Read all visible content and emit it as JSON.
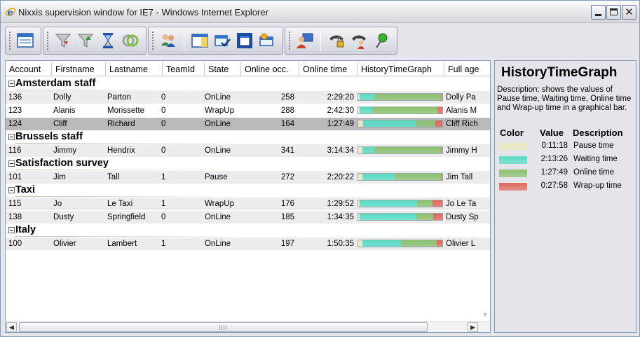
{
  "window": {
    "title": "Nixxis supervision window for IE7 - Windows Internet Explorer",
    "close_glyph": "✕"
  },
  "toolbar": {
    "groups": [
      [
        "window-icon"
      ],
      [
        "filter-down-icon",
        "filter-up-icon",
        "hourglass-icon",
        "rings-icon"
      ],
      [
        "agents-icon",
        "panel-icon",
        "check-window-icon",
        "maximize-window-icon",
        "window-star-icon"
      ],
      [
        "agent-computer-icon",
        "phone-lock-icon",
        "phone-agent-icon",
        "pin-icon"
      ]
    ]
  },
  "grid": {
    "columns": [
      "Account",
      "Firstname",
      "Lastname",
      "TeamId",
      "State",
      "Online occ.",
      "Online time",
      "HistoryTimeGraph",
      "Full age"
    ],
    "groups": [
      {
        "name": "Amsterdam staff",
        "rows": [
          {
            "account": "136",
            "firstname": "Dolly",
            "lastname": "Parton",
            "teamid": "0",
            "state": "OnLine",
            "online_occ": "258",
            "online_time": "2:29:20",
            "full": "Dolly Pa",
            "graph": [
              0.02,
              0.17,
              0.8,
              0.01
            ],
            "style": "alt"
          },
          {
            "account": "123",
            "firstname": "Alanis",
            "lastname": "Morissette",
            "teamid": "0",
            "state": "WrapUp",
            "online_occ": "288",
            "online_time": "2:42:30",
            "full": "Alanis M",
            "graph": [
              0.02,
              0.15,
              0.77,
              0.06
            ],
            "style": ""
          },
          {
            "account": "124",
            "firstname": "Cliff",
            "lastname": "Richard",
            "teamid": "0",
            "state": "OnLine",
            "online_occ": "164",
            "online_time": "1:27:49",
            "full": "Cliff Rich",
            "graph": [
              0.06,
              0.62,
              0.24,
              0.08
            ],
            "style": "sel"
          }
        ]
      },
      {
        "name": "Brussels staff",
        "rows": [
          {
            "account": "116",
            "firstname": "Jimmy",
            "lastname": "Hendrix",
            "teamid": "0",
            "state": "OnLine",
            "online_occ": "341",
            "online_time": "3:14:34",
            "full": "Jimmy H",
            "graph": [
              0.05,
              0.14,
              0.8,
              0.01
            ],
            "style": "alt"
          }
        ]
      },
      {
        "name": "Satisfaction survey",
        "rows": [
          {
            "account": "101",
            "firstname": "Jim",
            "lastname": "Tall",
            "teamid": "1",
            "state": "Pause",
            "online_occ": "272",
            "online_time": "2:20:22",
            "full": "Jim Tall",
            "graph": [
              0.05,
              0.38,
              0.56,
              0.01
            ],
            "style": "alt"
          }
        ]
      },
      {
        "name": "Taxi",
        "rows": [
          {
            "account": "115",
            "firstname": "Jo",
            "lastname": "Le Taxi",
            "teamid": "1",
            "state": "WrapUp",
            "online_occ": "176",
            "online_time": "1:29:52",
            "full": "Jo Le Ta",
            "graph": [
              0.02,
              0.68,
              0.18,
              0.12
            ],
            "style": "alt"
          },
          {
            "account": "138",
            "firstname": "Dusty",
            "lastname": "Springfield",
            "teamid": "0",
            "state": "OnLine",
            "online_occ": "185",
            "online_time": "1:34:35",
            "full": "Dusty Sp",
            "graph": [
              0.02,
              0.67,
              0.2,
              0.11
            ],
            "style": "alt"
          }
        ]
      },
      {
        "name": "Italy",
        "rows": [
          {
            "account": "100",
            "firstname": "Olivier",
            "lastname": "Lambert",
            "teamid": "1",
            "state": "OnLine",
            "online_occ": "197",
            "online_time": "1:50:35",
            "full": "Olivier L",
            "graph": [
              0.05,
              0.46,
              0.42,
              0.07
            ],
            "style": "alt"
          }
        ]
      }
    ],
    "scroll": {
      "left": "◀",
      "right": "▶",
      "down": "▼"
    }
  },
  "info": {
    "title": "HistoryTimeGraph",
    "description": "Description: shows the values of Pause time, Waiting time, Online time and Wrap-up time in a graphical bar.",
    "headers": {
      "color": "Color",
      "value": "Value",
      "description": "Description"
    },
    "legend": [
      {
        "value": "0:11:18",
        "description": "Pause time",
        "color": "#ece8c0"
      },
      {
        "value": "2:13:26",
        "description": "Waiting time",
        "color": "#58dcc4"
      },
      {
        "value": "1:27:49",
        "description": "Online time",
        "color": "#8cc070"
      },
      {
        "value": "0:27:58",
        "description": "Wrap-up time",
        "color": "#e0685c"
      }
    ]
  }
}
